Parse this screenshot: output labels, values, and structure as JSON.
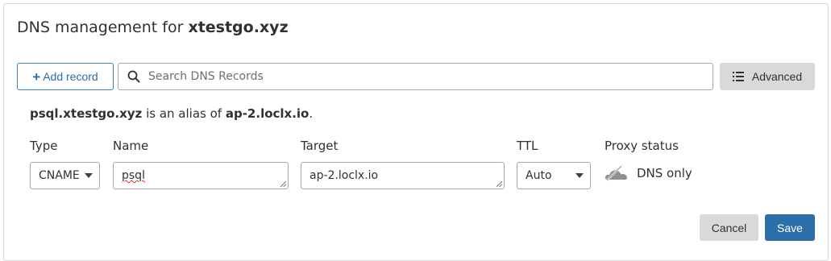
{
  "header": {
    "title_prefix": "DNS management for",
    "domain": "xtestgo.xyz"
  },
  "toolbar": {
    "add_record_label": "Add record",
    "search_placeholder": "Search DNS Records",
    "advanced_label": "Advanced"
  },
  "alias_notice": {
    "host": "psql.xtestgo.xyz",
    "middle": "is an alias of",
    "target": "ap-2.loclx.io",
    "suffix": "."
  },
  "record_form": {
    "type_label": "Type",
    "type_value": "CNAME",
    "name_label": "Name",
    "name_value": "psql",
    "target_label": "Target",
    "target_value": "ap-2.loclx.io",
    "ttl_label": "TTL",
    "ttl_value": "Auto",
    "proxy_label": "Proxy status",
    "proxy_value": "DNS only"
  },
  "actions": {
    "cancel_label": "Cancel",
    "save_label": "Save"
  },
  "colors": {
    "primary": "#2c6ea8",
    "border": "#a7a7a7",
    "secondary_button": "#d9d9d9",
    "text": "#313131"
  }
}
